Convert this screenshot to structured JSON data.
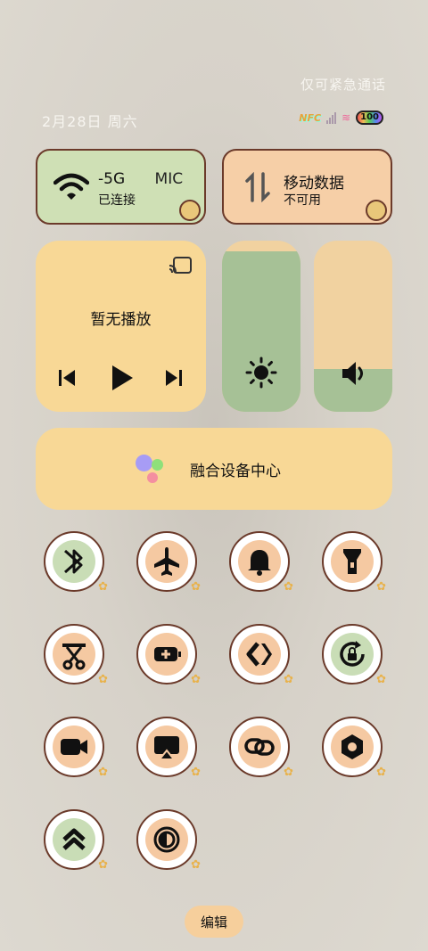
{
  "status": {
    "emergency": "仅可紧急通话",
    "date": "2月28日 周六",
    "nfc_label": "NFC",
    "battery": "100"
  },
  "wifi_tile": {
    "ssid": "-5G",
    "ssid_extra": "MIC",
    "status": "已连接",
    "icon": "wifi-icon"
  },
  "data_tile": {
    "title": "移动数据",
    "status": "不可用",
    "icon": "mobile-data-icon"
  },
  "media": {
    "title": "暂无播放",
    "cast_icon": "cast-icon",
    "prev_icon": "skip-previous-icon",
    "play_icon": "play-icon",
    "next_icon": "skip-next-icon"
  },
  "brightness": {
    "level": 0.94,
    "icon": "sun-icon"
  },
  "volume": {
    "level": 0.25,
    "icon": "speaker-icon"
  },
  "fusion": {
    "label": "融合设备中心"
  },
  "toggles": [
    {
      "name": "bluetooth",
      "icon": "bluetooth-icon",
      "color": "#c9ddb6"
    },
    {
      "name": "airplane",
      "icon": "airplane-icon",
      "color": "#f5c9a2"
    },
    {
      "name": "ring",
      "icon": "bell-icon",
      "color": "#f5c9a2"
    },
    {
      "name": "flashlight",
      "icon": "flashlight-icon",
      "color": "#f5c9a2"
    },
    {
      "name": "screenshot",
      "icon": "scissors-icon",
      "color": "#f5c9a2"
    },
    {
      "name": "battery-saver",
      "icon": "battery-plus-icon",
      "color": "#f5c9a2"
    },
    {
      "name": "nearby-share",
      "icon": "share-arrows-icon",
      "color": "#f5c9a2"
    },
    {
      "name": "auto-rotate",
      "icon": "rotate-lock-icon",
      "color": "#c9ddb6"
    },
    {
      "name": "screen-record",
      "icon": "video-camera-icon",
      "color": "#f5c9a2"
    },
    {
      "name": "screencast",
      "icon": "airplay-icon",
      "color": "#f5c9a2"
    },
    {
      "name": "link",
      "icon": "link-icon",
      "color": "#f5c9a2"
    },
    {
      "name": "nfc",
      "icon": "hexagon-nut-icon",
      "color": "#f5c9a2"
    },
    {
      "name": "performance",
      "icon": "chevrons-up-icon",
      "color": "#c9ddb6"
    },
    {
      "name": "dark-mode",
      "icon": "contrast-icon",
      "color": "#f5c9a2"
    }
  ],
  "edit_label": "编辑"
}
